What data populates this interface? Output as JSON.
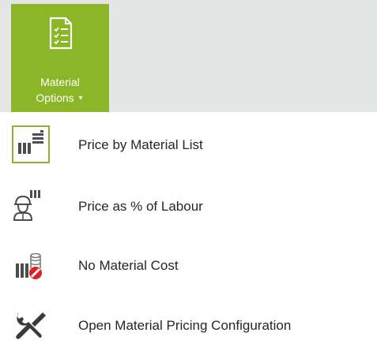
{
  "ribbon": {
    "button": {
      "label_line1": "Material",
      "label_line2": "Options",
      "icon": "checklist-icon",
      "dropdown_icon": "caret-down-icon"
    },
    "accent_color": "#8bb628",
    "background_color": "#e4e6e5"
  },
  "menu": {
    "items": [
      {
        "label": "Price by Material List",
        "icon": "material-list-icon",
        "selected": true
      },
      {
        "label": "Price as % of Labour",
        "icon": "labour-worker-icon",
        "selected": false
      },
      {
        "label": "No Material Cost",
        "icon": "no-cost-icon",
        "selected": false
      },
      {
        "label": "Open Material Pricing Configuration",
        "icon": "tools-icon",
        "selected": false
      }
    ]
  }
}
